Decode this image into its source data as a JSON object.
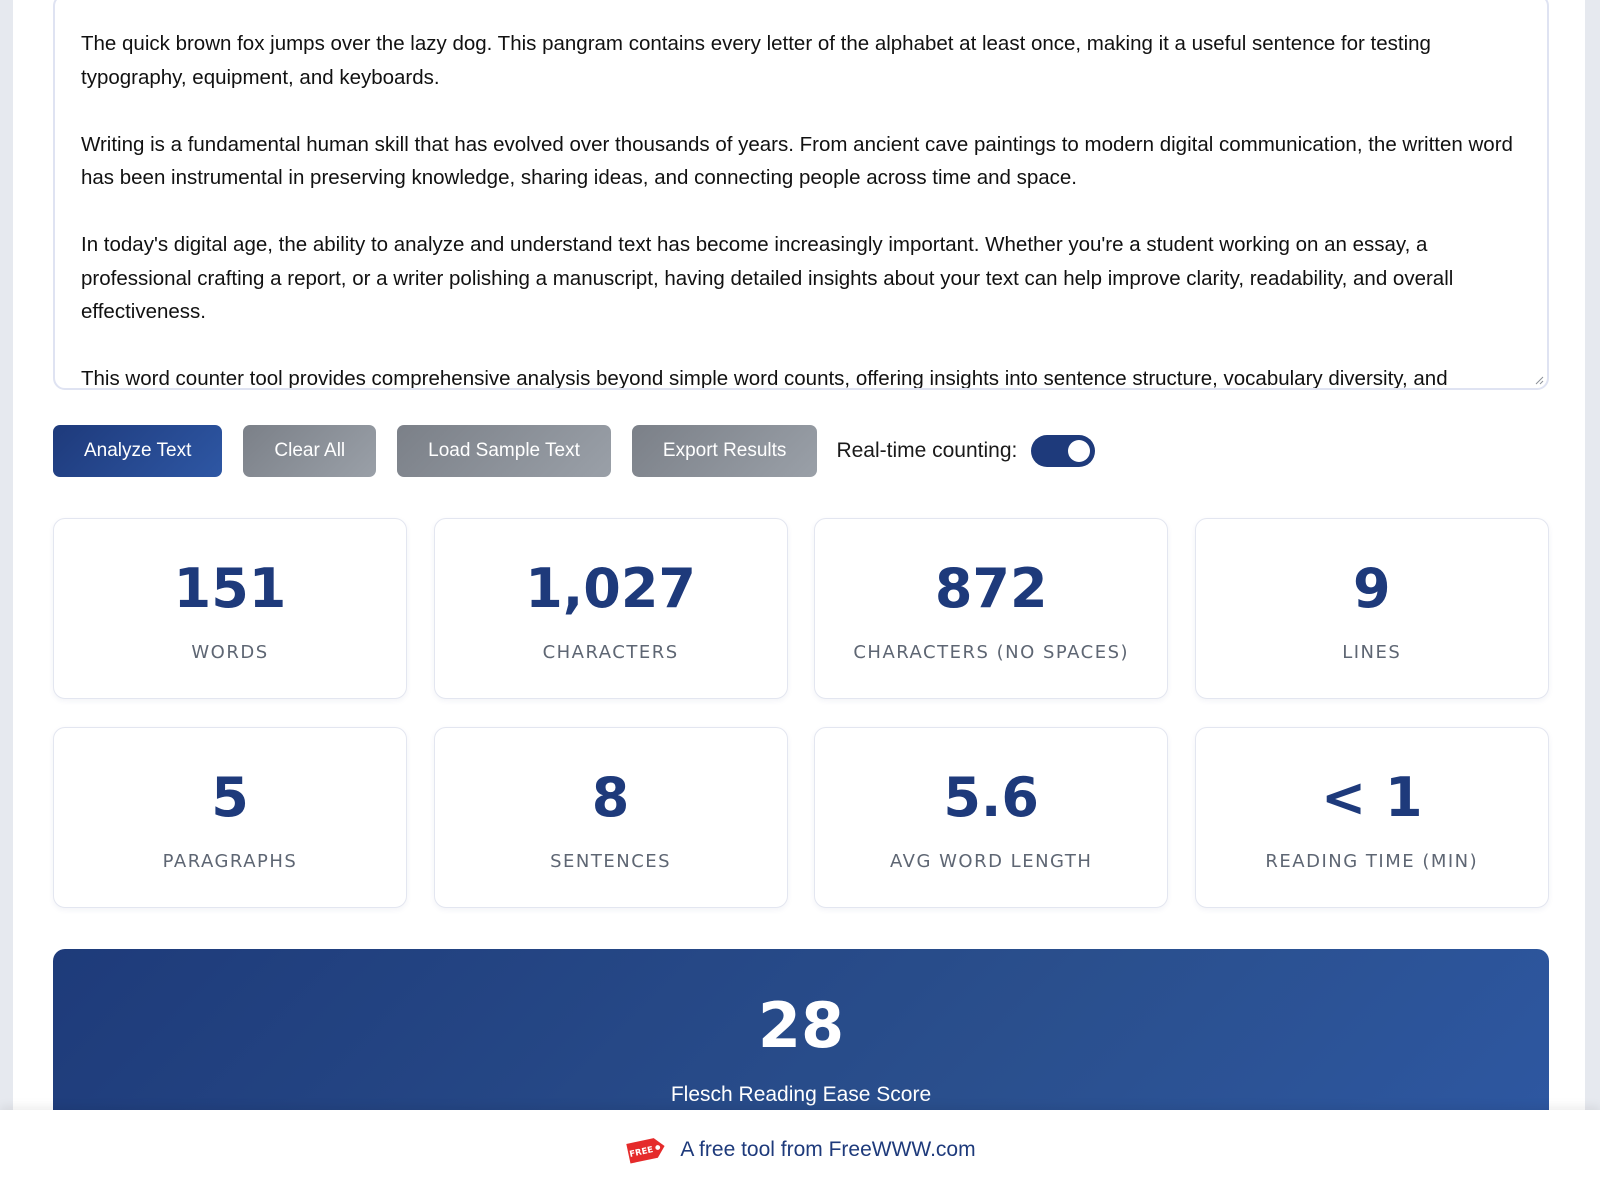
{
  "editor": {
    "paragraphs": [
      "The quick brown fox jumps over the lazy dog. This pangram contains every letter of the alphabet at least once, making it a useful sentence for testing typography, equipment, and keyboards.",
      "Writing is a fundamental human skill that has evolved over thousands of years. From ancient cave paintings to modern digital communication, the written word has been instrumental in preserving knowledge, sharing ideas, and connecting people across time and space.",
      "In today's digital age, the ability to analyze and understand text has become increasingly important. Whether you're a student working on an essay, a professional crafting a report, or a writer polishing a manuscript, having detailed insights about your text can help improve clarity, readability, and overall effectiveness.",
      "This word counter tool provides comprehensive analysis beyond simple word counts, offering insights into sentence structure, vocabulary diversity, and"
    ]
  },
  "controls": {
    "analyze_label": "Analyze Text",
    "clear_label": "Clear All",
    "sample_label": "Load Sample Text",
    "export_label": "Export Results",
    "realtime_label": "Real-time counting:",
    "realtime_enabled": true
  },
  "stats": [
    {
      "value": "151",
      "label": "WORDS"
    },
    {
      "value": "1,027",
      "label": "CHARACTERS"
    },
    {
      "value": "872",
      "label": "CHARACTERS (NO SPACES)"
    },
    {
      "value": "9",
      "label": "LINES"
    },
    {
      "value": "5",
      "label": "PARAGRAPHS"
    },
    {
      "value": "8",
      "label": "SENTENCES"
    },
    {
      "value": "5.6",
      "label": "AVG WORD LENGTH"
    },
    {
      "value": "< 1",
      "label": "READING TIME (MIN)"
    }
  ],
  "readability": {
    "score": "28",
    "label": "Flesch Reading Ease Score"
  },
  "footer": {
    "badge_text": "FREE",
    "text": "A free tool from FreeWWW.com"
  },
  "colors": {
    "primary": "#1e3a7b",
    "secondary_button": "#8a8f97",
    "stat_value": "#1e3a7b",
    "stat_label": "#5e6673",
    "badge": "#e52b2b"
  }
}
